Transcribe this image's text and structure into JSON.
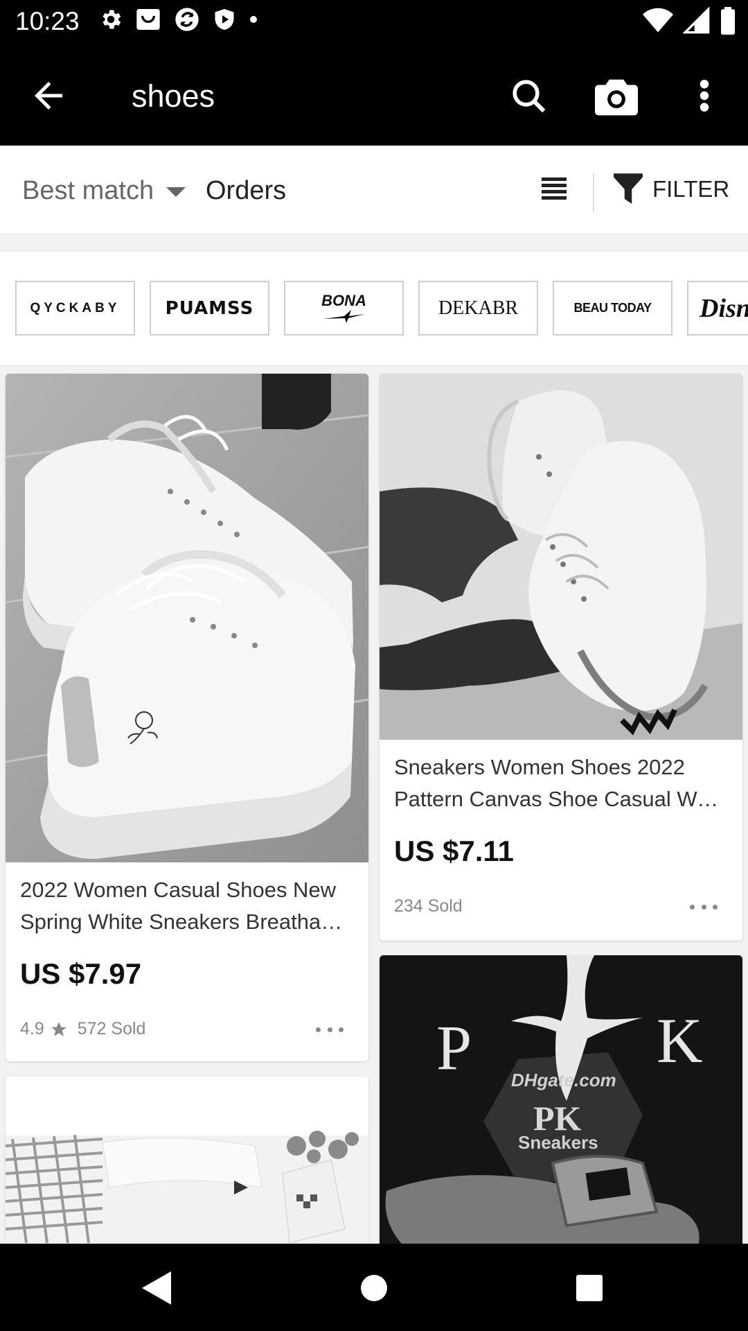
{
  "status_bar": {
    "time": "10:23",
    "left_icons": [
      "settings-icon",
      "bag-icon",
      "sync-icon",
      "shield-icon",
      "dot-icon"
    ],
    "right_icons": [
      "wifi-icon",
      "signal-icon",
      "battery-icon"
    ]
  },
  "app_bar": {
    "query": "shoes",
    "actions": [
      "back-arrow-icon",
      "search-icon",
      "camera-icon",
      "more-vert-icon"
    ]
  },
  "sort_bar": {
    "best_match": "Best match",
    "orders": "Orders",
    "filter": "FILTER"
  },
  "brands": [
    "QYCKABY",
    "PUAMSS",
    "BONA",
    "DEKABR",
    "BEAU TODAY",
    "Disney"
  ],
  "products": [
    {
      "title_line1": "2022 Women Casual Shoes New",
      "title_line2": "Spring White Sneakers Breathab…",
      "price": "US $7.97",
      "rating": "4.9",
      "sold": "572 Sold"
    },
    {
      "title_line1": "Sneakers Women Shoes 2022",
      "title_line2": "Pattern Canvas Shoe Casual Wo…",
      "price": "US $7.11",
      "sold": "234 Sold"
    },
    {
      "image_text": [
        "P",
        "K",
        "DHgate.com",
        "PK",
        "Sneakers"
      ]
    }
  ],
  "nav_bar": [
    "nav-back-icon",
    "nav-home-icon",
    "nav-recents-icon"
  ],
  "colors": {
    "bars": "#000000",
    "background": "#f2f2f2",
    "price": "#111111",
    "muted": "#888888"
  }
}
